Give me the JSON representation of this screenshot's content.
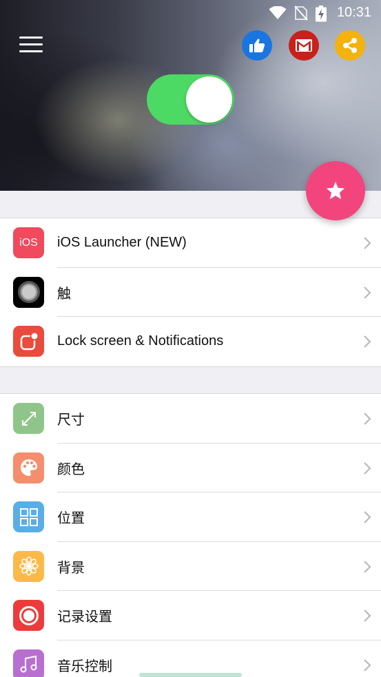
{
  "status_bar": {
    "time": "10:31",
    "icons": [
      "wifi-icon",
      "no-sim-icon",
      "battery-charging-icon"
    ]
  },
  "header": {
    "menu_icon": "hamburger-menu-icon",
    "actions": [
      {
        "name": "like",
        "icon": "thumbs-up-icon",
        "color": "#1976e0"
      },
      {
        "name": "mail",
        "icon": "gmail-icon",
        "color": "#c8211b"
      },
      {
        "name": "share",
        "icon": "share-icon",
        "color": "#f3b20d"
      }
    ],
    "main_toggle": {
      "on": true,
      "color": "#4cd964"
    }
  },
  "fab": {
    "icon": "star-icon",
    "color": "#f2457e"
  },
  "section1": {
    "items": [
      {
        "label": "iOS Launcher (NEW)",
        "icon": "ios-icon",
        "icon_text": "iOS",
        "color": "#ef4a5e"
      },
      {
        "label": "触",
        "icon": "assistive-touch-icon",
        "color": "#000000"
      },
      {
        "label": "Lock screen & Notifications",
        "icon": "notification-icon",
        "color": "#ea4b3c"
      }
    ]
  },
  "section2": {
    "items": [
      {
        "label": "尺寸",
        "icon": "resize-icon",
        "color": "#8fc58a"
      },
      {
        "label": "颜色",
        "icon": "palette-icon",
        "color": "#f48e6c"
      },
      {
        "label": "位置",
        "icon": "grid-position-icon",
        "color": "#5aaee6"
      },
      {
        "label": "背景",
        "icon": "flower-background-icon",
        "color": "#fbb948"
      },
      {
        "label": "记录设置",
        "icon": "record-icon",
        "color": "#ed3b3b"
      },
      {
        "label": "音乐控制",
        "icon": "music-icon",
        "color": "#b86fd0"
      }
    ]
  }
}
